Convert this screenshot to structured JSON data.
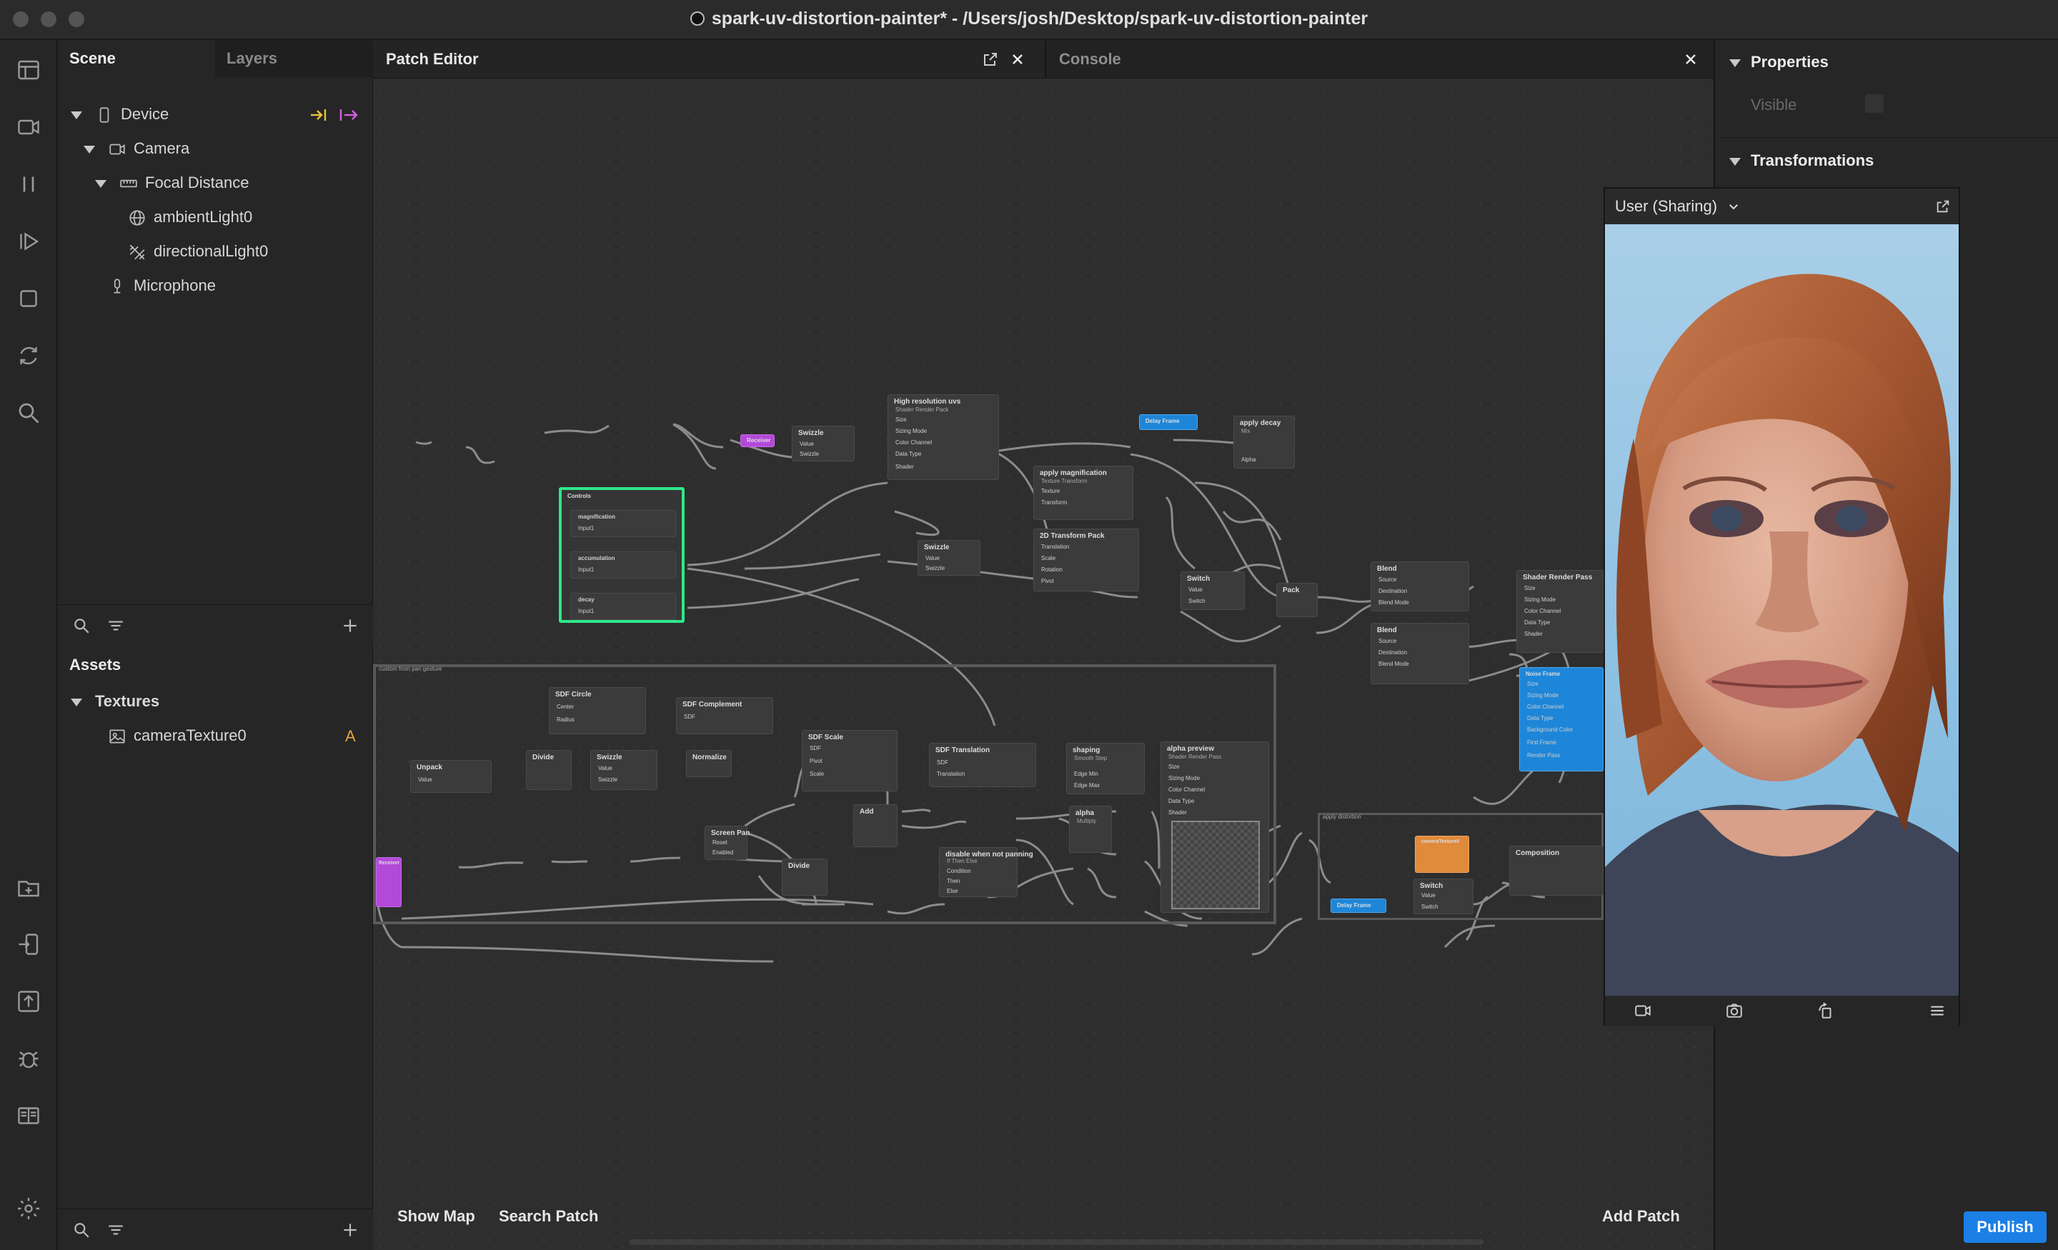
{
  "window": {
    "title": "spark-uv-distortion-painter* - /Users/josh/Desktop/spark-uv-distortion-painter"
  },
  "toolbar": {
    "tools": [
      "layout-icon",
      "video-icon",
      "pause-icon",
      "play-icon",
      "square-icon",
      "sync-icon",
      "search-icon",
      "add-asset-icon",
      "device-icon",
      "upload-icon",
      "bug-icon",
      "docs-icon",
      "settings-icon"
    ]
  },
  "scene": {
    "tabs": [
      "Scene",
      "Layers"
    ],
    "tree": [
      {
        "label": "Device"
      },
      {
        "label": "Camera"
      },
      {
        "label": "Focal Distance"
      },
      {
        "label": "ambientLight0"
      },
      {
        "label": "directionalLight0"
      },
      {
        "label": "Microphone"
      }
    ]
  },
  "assets": {
    "title": "Assets",
    "group": "Textures",
    "items": [
      {
        "label": "cameraTexture0",
        "badge": "A"
      }
    ]
  },
  "patch_editor": {
    "title": "Patch Editor",
    "console_title": "Console",
    "show_map": "Show Map",
    "search_patch": "Search Patch",
    "add_patch": "Add Patch",
    "groups": [
      {
        "title": "custom from pan gesture"
      },
      {
        "title": "apply distortion"
      }
    ],
    "nodes": [
      {
        "id": "n-receiver",
        "title": "Receiver",
        "color": "#b349d9",
        "rows": []
      },
      {
        "id": "n-swizzle1",
        "title": "Swizzle",
        "rows": [
          "Value",
          "Swizzle"
        ]
      },
      {
        "id": "n-hires",
        "title": "High resolution uvs",
        "subtitle": "Shader Render Pack",
        "rows": [
          "Size",
          "Sizing Mode",
          "Color Channel",
          "Data Type",
          "Shader"
        ]
      },
      {
        "id": "n-delayframe1",
        "title": "Delay Frame",
        "color": "#1e86d8",
        "rows": []
      },
      {
        "id": "n-applydecay",
        "title": "apply decay",
        "subtitle": "Mix",
        "rows": [
          "",
          "",
          "Alpha"
        ]
      },
      {
        "id": "n-applymag",
        "title": "apply magnification",
        "subtitle": "Texture Transform",
        "rows": [
          "Texture",
          "Transform"
        ]
      },
      {
        "id": "n-controls",
        "title": "Controls",
        "rows": [
          "magnification",
          "Input1",
          "accumulation",
          "Input1",
          "decay",
          "Input1"
        ]
      },
      {
        "id": "n-swizzle2",
        "title": "Swizzle",
        "rows": [
          "Value",
          "Swizzle"
        ]
      },
      {
        "id": "n-2dtransform",
        "title": "2D Transform Pack",
        "rows": [
          "Translation",
          "Scale",
          "Rotation",
          "Pivot"
        ]
      },
      {
        "id": "n-swizzle3",
        "title": "Switch",
        "rows": [
          "Value",
          "Switch"
        ]
      },
      {
        "id": "n-pack",
        "title": "Pack",
        "rows": [
          "",
          ""
        ]
      },
      {
        "id": "n-blend1",
        "title": "Blend",
        "rows": [
          "Source",
          "Destination",
          "Blend Mode"
        ]
      },
      {
        "id": "n-blend2",
        "title": "Blend",
        "rows": [
          "Source",
          "Destination",
          "Blend Mode"
        ]
      },
      {
        "id": "n-srp",
        "title": "Shader Render Pass",
        "rows": [
          "Size",
          "Sizing Mode",
          "Color Channel",
          "Data Type",
          "Shader"
        ]
      },
      {
        "id": "n-sdfcircle",
        "title": "SDF Circle",
        "rows": [
          "Center",
          "Radius"
        ]
      },
      {
        "id": "n-sdfcomp",
        "title": "SDF Complement",
        "rows": [
          "SDF"
        ]
      },
      {
        "id": "n-unpack",
        "title": "Unpack",
        "rows": [
          "Value"
        ]
      },
      {
        "id": "n-divide1",
        "title": "Divide",
        "rows": [
          "",
          ""
        ]
      },
      {
        "id": "n-swizzle4",
        "title": "Swizzle",
        "rows": [
          "Value",
          "Swizzle"
        ]
      },
      {
        "id": "n-normalize",
        "title": "Normalize",
        "rows": [
          ""
        ]
      },
      {
        "id": "n-sdfscale",
        "title": "SDF Scale",
        "rows": [
          "SDF",
          "Pivot",
          "Scale"
        ]
      },
      {
        "id": "n-sdftrans",
        "title": "SDF Translation",
        "rows": [
          "SDF",
          "Translation"
        ]
      },
      {
        "id": "n-shaping",
        "title": "shaping",
        "subtitle": "Smooth Step",
        "rows": [
          "",
          "Edge Min",
          "Edge Max"
        ]
      },
      {
        "id": "n-alphapreview",
        "title": "alpha preview",
        "subtitle": "Shader Render Pass",
        "rows": [
          "Size",
          "Sizing Mode",
          "Color Channel",
          "Data Type",
          "Shader"
        ]
      },
      {
        "id": "n-screenpan",
        "title": "Screen Pan",
        "rows": [
          "Reset",
          "Enabled"
        ]
      },
      {
        "id": "n-add",
        "title": "Add",
        "rows": [
          "",
          ""
        ]
      },
      {
        "id": "n-alpha",
        "title": "alpha",
        "subtitle": "Multiply",
        "rows": [
          "",
          ""
        ]
      },
      {
        "id": "n-divide2",
        "title": "Divide",
        "rows": [
          "",
          ""
        ]
      },
      {
        "id": "n-disable",
        "title": "disable when not panning",
        "subtitle": "If Then Else",
        "rows": [
          "Condition",
          "Then",
          "Else"
        ]
      },
      {
        "id": "n-camtex",
        "title": "cameraTexture0",
        "color": "#e08a3c",
        "rows": []
      },
      {
        "id": "n-composition",
        "title": "Composition",
        "rows": [
          "",
          ""
        ]
      },
      {
        "id": "n-delayframe2",
        "title": "Delay Frame",
        "color": "#1e86d8",
        "rows": []
      },
      {
        "id": "n-swizzle5",
        "title": "Switch",
        "rows": [
          "Value",
          "Switch"
        ]
      },
      {
        "id": "n-bluepatch",
        "title": "Noise Frame",
        "color": "#1e86d8",
        "rows": [
          "Size",
          "Sizing Mode",
          "Color Channel",
          "Data Type",
          "Background Color",
          "First Frame",
          "Render Pass"
        ]
      },
      {
        "id": "n-receiver2",
        "title": "Receiver",
        "color": "#b349d9",
        "rows": []
      }
    ]
  },
  "properties": {
    "title": "Properties",
    "visible_label": "Visible",
    "transformations": "Transformations"
  },
  "simulator": {
    "title": "User (Sharing)"
  },
  "publish_label": "Publish",
  "colors": {
    "accent": "#1b7fe5",
    "selection": "#2ee88a",
    "receiver": "#b349d9",
    "blue_patch": "#1e86d8",
    "texture_patch": "#e08a3c",
    "device_yellow": "#e8c43c",
    "device_pink": "#d560e0"
  }
}
